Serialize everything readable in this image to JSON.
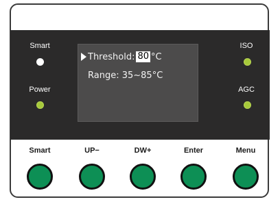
{
  "indicators": {
    "smart": {
      "label": "Smart",
      "color": "#ffffff"
    },
    "power": {
      "label": "Power",
      "color": "#a6c93a"
    },
    "iso": {
      "label": "ISO",
      "color": "#a6c93a"
    },
    "agc": {
      "label": "AGC",
      "color": "#a6c93a"
    }
  },
  "display": {
    "threshold_label": "Threshold:",
    "threshold_value": "80",
    "threshold_unit": "°C",
    "range_text": "Range: 35~85°C"
  },
  "buttons": [
    {
      "label": "Smart"
    },
    {
      "label": "UP−"
    },
    {
      "label": "DW+"
    },
    {
      "label": "Enter"
    },
    {
      "label": "Menu"
    }
  ],
  "colors": {
    "panel": "#2b2a2a",
    "screen": "#4c4b4b",
    "button_green": "#0d8f55",
    "led_green": "#a6c93a"
  }
}
